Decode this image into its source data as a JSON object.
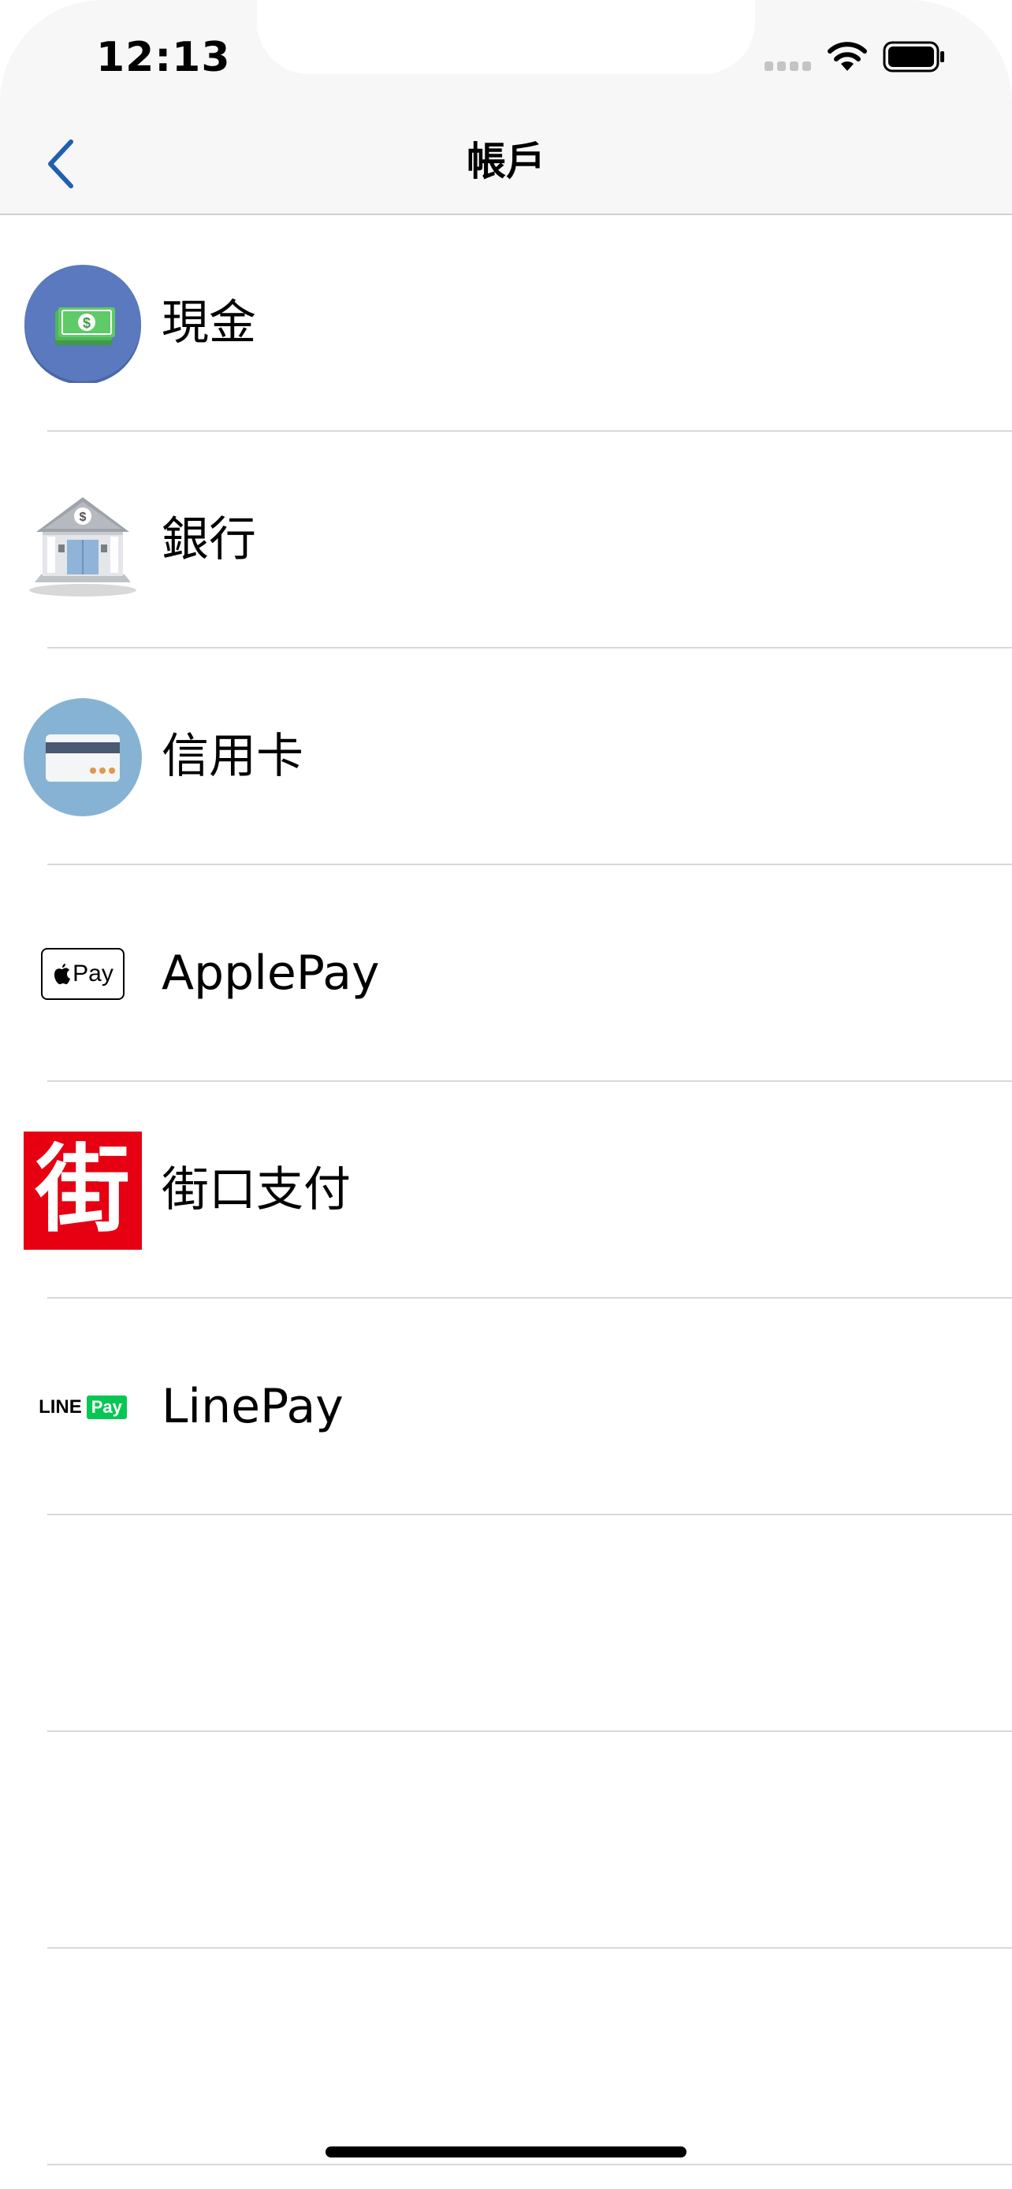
{
  "status_bar": {
    "time": "12:13"
  },
  "nav": {
    "title": "帳戶"
  },
  "accounts": [
    {
      "label": "現金",
      "icon": "cash-icon"
    },
    {
      "label": "銀行",
      "icon": "bank-icon"
    },
    {
      "label": "信用卡",
      "icon": "credit-card-icon"
    },
    {
      "label": "ApplePay",
      "icon": "apple-pay-icon",
      "icon_text": "Pay"
    },
    {
      "label": "街口支付",
      "icon": "jko-pay-icon",
      "icon_text": "街"
    },
    {
      "label": "LinePay",
      "icon": "line-pay-icon",
      "icon_text": [
        "LINE",
        "Pay"
      ]
    }
  ],
  "colors": {
    "nav_accent": "#1f5fb0",
    "cash_circle": "#5b79be",
    "card_circle": "#86b3d4",
    "jko_red": "#e60012",
    "line_green": "#06c755"
  }
}
